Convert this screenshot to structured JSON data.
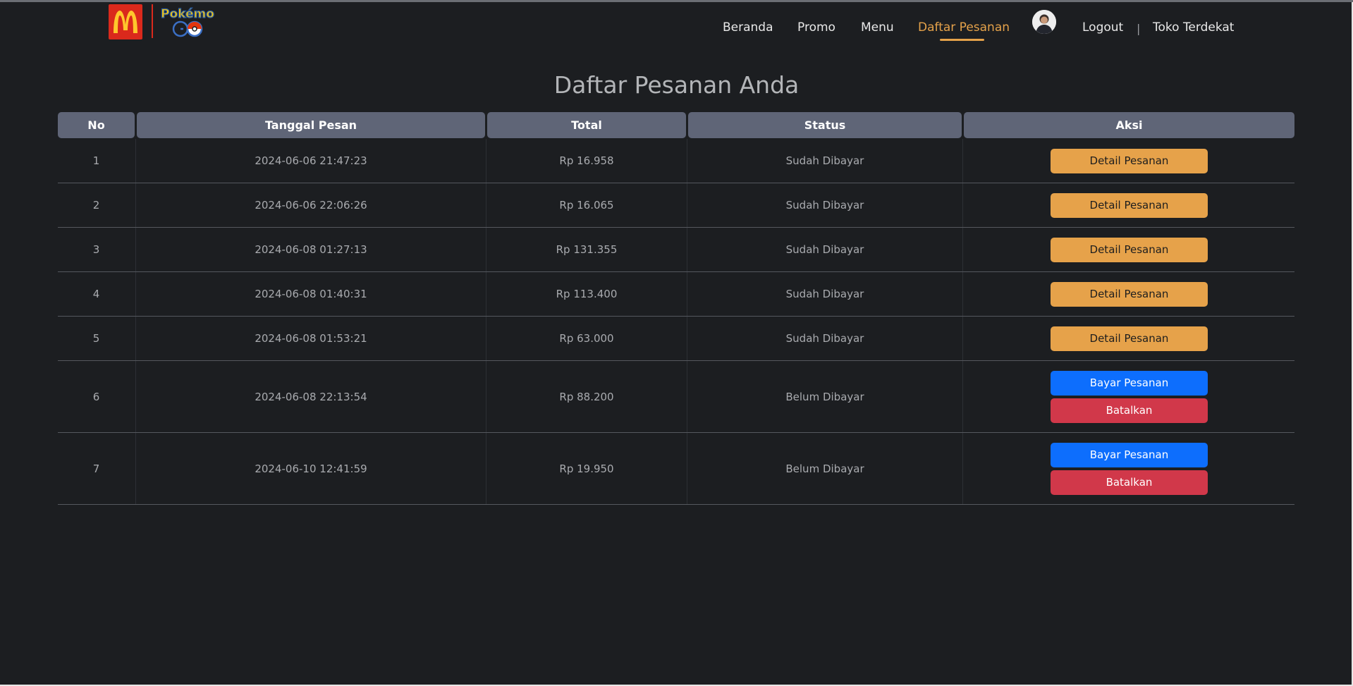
{
  "brand": {
    "mcd_logo": "M",
    "pokemon_logo": "Pokémon GO",
    "colors": {
      "mcd_red": "#da291c",
      "accent": "#e5a24a"
    }
  },
  "nav": {
    "items": [
      {
        "label": "Beranda",
        "active": false
      },
      {
        "label": "Promo",
        "active": false
      },
      {
        "label": "Menu",
        "active": false
      },
      {
        "label": "Daftar Pesanan",
        "active": true
      },
      {
        "label": "Logout",
        "active": false
      },
      {
        "label": "Toko Terdekat",
        "active": false
      }
    ],
    "separator": "|",
    "avatar_icon": "user-avatar"
  },
  "page": {
    "title": "Daftar Pesanan Anda"
  },
  "table": {
    "headers": [
      "No",
      "Tanggal Pesan",
      "Total",
      "Status",
      "Aksi"
    ],
    "rows": [
      {
        "no": "1",
        "date": "2024-06-06 21:47:23",
        "total": "Rp 16.958",
        "status": "Sudah Dibayar",
        "actions": [
          "Detail Pesanan"
        ]
      },
      {
        "no": "2",
        "date": "2024-06-06 22:06:26",
        "total": "Rp 16.065",
        "status": "Sudah Dibayar",
        "actions": [
          "Detail Pesanan"
        ]
      },
      {
        "no": "3",
        "date": "2024-06-08 01:27:13",
        "total": "Rp 131.355",
        "status": "Sudah Dibayar",
        "actions": [
          "Detail Pesanan"
        ]
      },
      {
        "no": "4",
        "date": "2024-06-08 01:40:31",
        "total": "Rp 113.400",
        "status": "Sudah Dibayar",
        "actions": [
          "Detail Pesanan"
        ]
      },
      {
        "no": "5",
        "date": "2024-06-08 01:53:21",
        "total": "Rp 63.000",
        "status": "Sudah Dibayar",
        "actions": [
          "Detail Pesanan"
        ]
      },
      {
        "no": "6",
        "date": "2024-06-08 22:13:54",
        "total": "Rp 88.200",
        "status": "Belum Dibayar",
        "actions": [
          "Bayar Pesanan",
          "Batalkan"
        ]
      },
      {
        "no": "7",
        "date": "2024-06-10 12:41:59",
        "total": "Rp 19.950",
        "status": "Belum Dibayar",
        "actions": [
          "Bayar Pesanan",
          "Batalkan"
        ]
      }
    ]
  }
}
